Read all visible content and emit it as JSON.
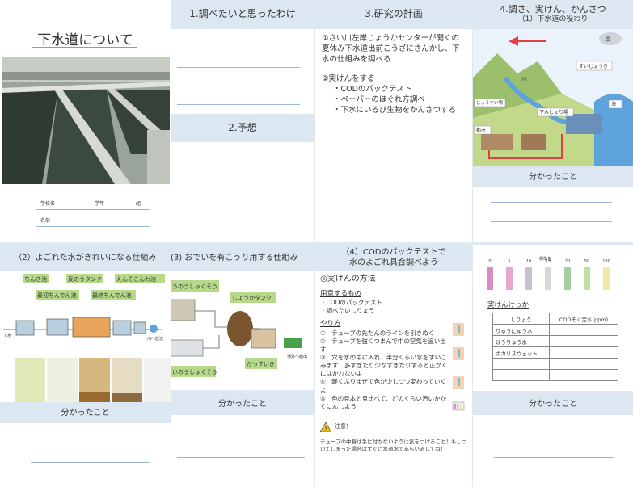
{
  "cover": {
    "title": "下水道について",
    "school_label": "学校名",
    "grade_label": "学年",
    "class_label": "組",
    "name_label": "名前"
  },
  "panel1": {
    "heading": "1.調べたいと思ったわけ"
  },
  "panel2": {
    "heading": "2.予想"
  },
  "panel3": {
    "heading": "3.研究の計画",
    "item1": "①さい川左岸じょうかセンターが開くの夏休み下水道出前こうざにさんかし、下水の仕組みを調べる",
    "item2": "②実けんをする",
    "bullets": [
      "・CODのパックテスト",
      "・ペーパーのほぐれ方調べ",
      "・下水にいるび生物をかんさつする"
    ]
  },
  "panel4": {
    "heading": "4.調さ、実けん、かんさつ",
    "subheading": "（1）下水道の役わり",
    "diagram_labels": {
      "cloud": "雲",
      "purification": "すいじょうき",
      "river": "川",
      "water_plant": "じょうすい場",
      "sewage_plant": "下水しょり場",
      "city": "都市",
      "sea": "海"
    },
    "found": "分かったこと"
  },
  "panel5": {
    "heading": "（2）よごれた水がきれいになる仕組み",
    "labels": [
      "ちんさ池",
      "反のうタンク",
      "えんそこんわ池",
      "最初ちんでん池",
      "最終ちんでん池"
    ],
    "small_left": "下水",
    "small_right": "川へ放流",
    "found": "分かったこと"
  },
  "panel6": {
    "heading": "(3) おでいを有こうり用する仕組み",
    "labels": [
      "うのうしゅくそう",
      "しょうかタンク",
      "いのうしゅくそう",
      "だっすいき"
    ],
    "small": "場外へ搬出",
    "found": "分かったこと"
  },
  "panel7": {
    "heading_line1": "（4）CODのパックテストで",
    "heading_line2": "水のよごれ具合調べよう",
    "method": "◎実けんの方法",
    "prep_title": "用意するもの",
    "prep": [
      "・CODのパックテスト",
      "・調べたいしりょう"
    ],
    "steps_title": "やり方",
    "steps": [
      "①　チューブの先たんのラインを引きぬく",
      "②　チューブを強くつまんで中の空気を追い出す",
      "③　穴を水の中に入れ、半分くらい水をすいこみます　多すぎたり少なすぎたりすると正かくにはかれないよ",
      "④　軽くふりまぜて色が少しづつ変わっていくよ",
      "⑤　色の見本と見比べて、どのくらい汚いかかくにんしよう"
    ],
    "caution_label": "注意！",
    "caution_text": "チューブの中身は手に付かないように気をつけること！もしついてしまった場合はすぐに水道水であらい流してね！"
  },
  "panel8": {
    "scale_title": "標準色",
    "scale_values": [
      "0",
      "5",
      "10",
      "13",
      "20",
      "50",
      "100"
    ],
    "scale_colors": [
      "#d98bc4",
      "#e6a6cf",
      "#c8c0cc",
      "#d8d8d8",
      "#a4cfa2",
      "#bfe0a0",
      "#f2e7a6"
    ],
    "result_title": "実けんけっか",
    "table_headers": [
      "しりょう",
      "CODそく定ち(ppm)"
    ],
    "table_rows": [
      "りゅうにゅう水",
      "ほうりゅう水",
      "ポカリスウェット",
      "",
      ""
    ],
    "found": "分かったこと"
  }
}
